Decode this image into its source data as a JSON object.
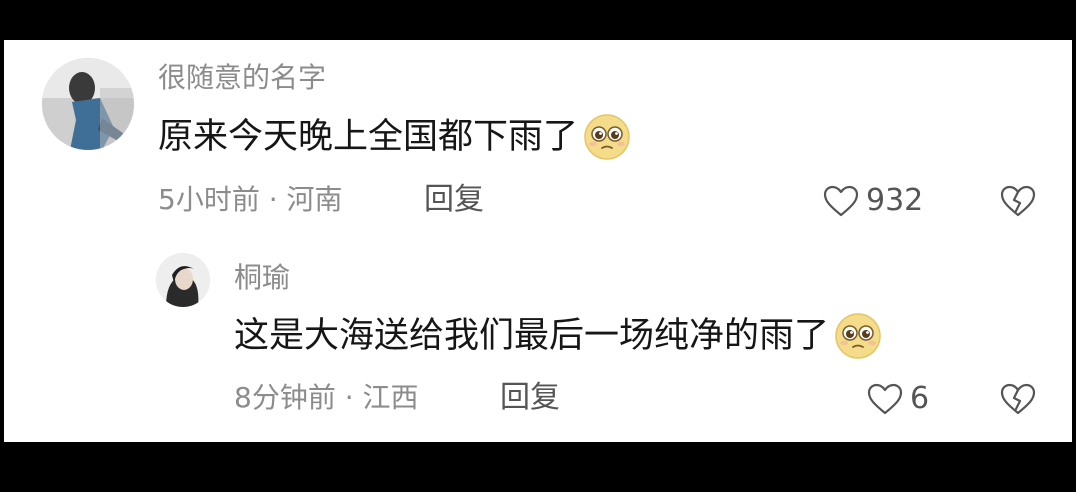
{
  "comment": {
    "username": "很随意的名字",
    "text": "原来今天晚上全国都下雨了",
    "meta": "5小时前 · 河南",
    "reply_label": "回复",
    "likes": "932",
    "emoji": "pleading-face-emoji"
  },
  "reply": {
    "username": "桐瑜",
    "text": "这是大海送给我们最后一场纯净的雨了",
    "meta": "8分钟前 · 江西",
    "reply_label": "回复",
    "likes": "6",
    "emoji": "pleading-face-emoji"
  },
  "icons": {
    "like": "heart-outline-icon",
    "dislike": "broken-heart-icon"
  }
}
